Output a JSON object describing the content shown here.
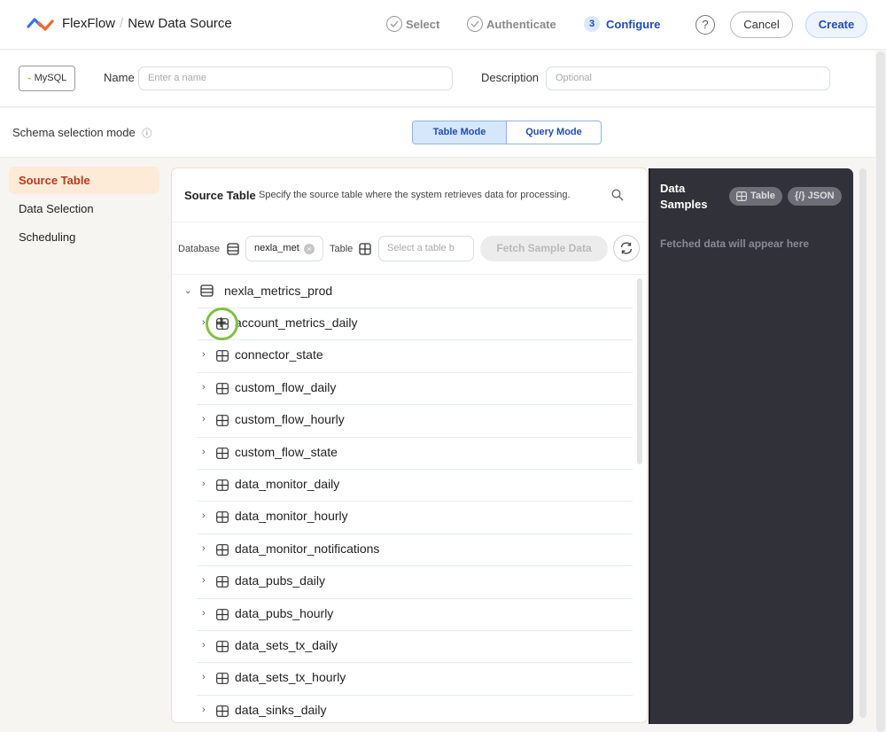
{
  "header": {
    "app_name": "FlexFlow",
    "separator": "/",
    "page_title": "New Data Source",
    "steps": [
      {
        "label": "Select",
        "state": "done"
      },
      {
        "label": "Authenticate",
        "state": "done"
      },
      {
        "label": "Configure",
        "state": "active",
        "number": "3"
      }
    ],
    "help_icon": "?",
    "cancel_label": "Cancel",
    "create_label": "Create"
  },
  "form": {
    "connector_label": "MySQL",
    "name_label": "Name",
    "name_value": "",
    "name_placeholder": "Enter a name",
    "description_label": "Description",
    "description_value": "",
    "description_placeholder": "Optional"
  },
  "schema_mode": {
    "label": "Schema selection mode",
    "info_icon": "ⓘ",
    "options": [
      "Table Mode",
      "Query Mode"
    ],
    "selected": "Table Mode"
  },
  "sidebar": {
    "items": [
      {
        "label": "Source Table",
        "active": true
      },
      {
        "label": "Data Selection",
        "active": false
      },
      {
        "label": "Scheduling",
        "active": false
      }
    ]
  },
  "source_table": {
    "title": "Source Table",
    "description": "Specify the source table where the system retrieves data for processing.",
    "database_label": "Database",
    "database_value": "nexla_met",
    "table_label": "Table",
    "table_value": "",
    "table_placeholder": "Select a table b",
    "fetch_label": "Fetch Sample Data",
    "tree": {
      "database": "nexla_metrics_prod",
      "expanded": true,
      "tables": [
        "account_metrics_daily",
        "connector_state",
        "custom_flow_daily",
        "custom_flow_hourly",
        "custom_flow_state",
        "data_monitor_daily",
        "data_monitor_hourly",
        "data_monitor_notifications",
        "data_pubs_daily",
        "data_pubs_hourly",
        "data_sets_tx_daily",
        "data_sets_tx_hourly",
        "data_sinks_daily"
      ]
    }
  },
  "data_samples": {
    "title": "Data Samples",
    "table_view_label": "Table",
    "json_view_label": "{/} JSON",
    "empty_text": "Fetched data will appear here"
  },
  "colors": {
    "accent_blue": "#1f4bbf",
    "active_nav_bg": "#fdebd8",
    "active_nav_text": "#b63b1a",
    "samples_bg": "#31313a",
    "cursor_ring": "#7dc242"
  }
}
